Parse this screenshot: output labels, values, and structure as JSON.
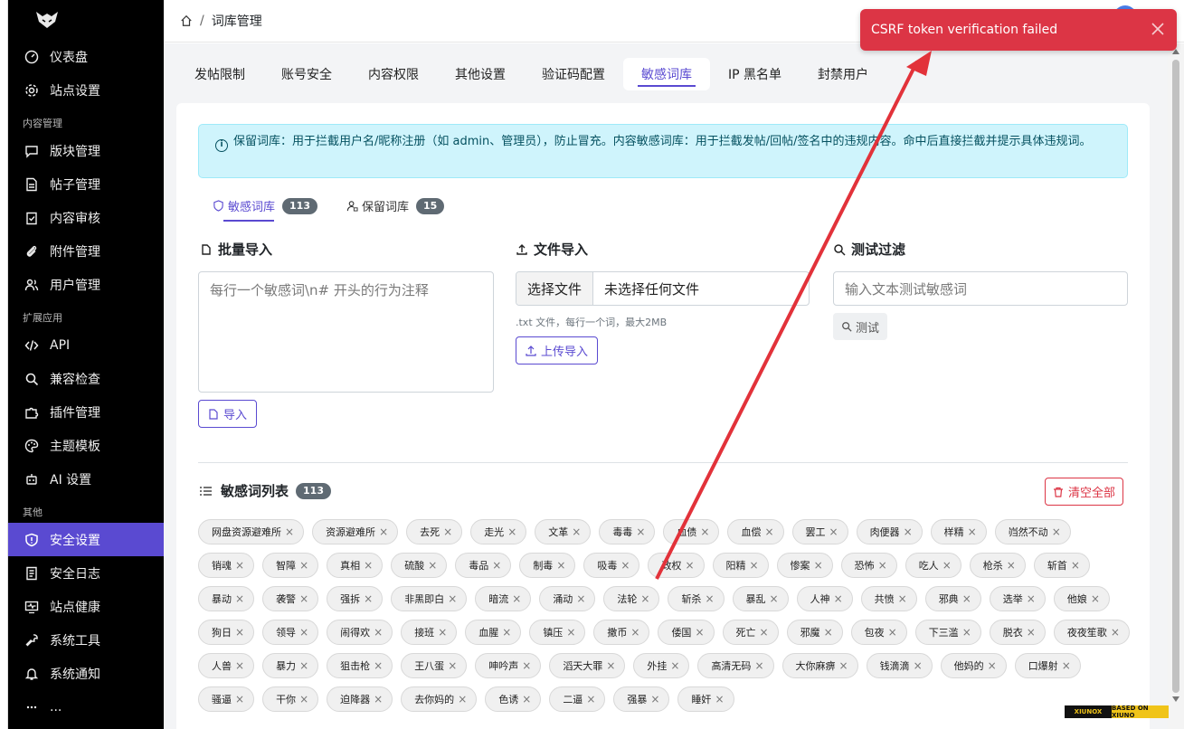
{
  "sidebar": {
    "items_top": [
      {
        "label": "仪表盘",
        "icon": "dashboard-icon"
      },
      {
        "label": "站点设置",
        "icon": "gear-icon"
      }
    ],
    "section_content": "内容管理",
    "items_content": [
      {
        "label": "版块管理",
        "icon": "chat-icon"
      },
      {
        "label": "帖子管理",
        "icon": "file-icon"
      },
      {
        "label": "内容审核",
        "icon": "clipboard-check-icon"
      },
      {
        "label": "附件管理",
        "icon": "paperclip-icon"
      },
      {
        "label": "用户管理",
        "icon": "users-icon"
      }
    ],
    "section_ext": "扩展应用",
    "items_ext": [
      {
        "label": "API",
        "icon": "code-icon"
      },
      {
        "label": "兼容检查",
        "icon": "search-icon"
      },
      {
        "label": "插件管理",
        "icon": "puzzle-icon"
      },
      {
        "label": "主题模板",
        "icon": "palette-icon"
      },
      {
        "label": "AI 设置",
        "icon": "robot-icon"
      }
    ],
    "section_other": "其他",
    "items_other": [
      {
        "label": "安全设置",
        "icon": "shield-icon",
        "active": true
      },
      {
        "label": "安全日志",
        "icon": "journal-icon"
      },
      {
        "label": "站点健康",
        "icon": "monitor-heart-icon"
      },
      {
        "label": "系统工具",
        "icon": "wrench-icon"
      },
      {
        "label": "系统通知",
        "icon": "bell-icon"
      },
      {
        "label": "...",
        "icon": "more-icon"
      }
    ]
  },
  "header": {
    "breadcrumb_sep": "/",
    "title": "词库管理"
  },
  "tabs": [
    "发帖限制",
    "账号安全",
    "内容权限",
    "其他设置",
    "验证码配置",
    "敏感词库",
    "IP 黑名单",
    "封禁用户"
  ],
  "active_tab": "敏感词库",
  "alert": {
    "text": "保留词库：用于拦截用户名/昵称注册（如 admin、管理员），防止冒充。内容敏感词库：用于拦截发帖/回帖/签名中的违规内容。命中后直接拦截并提示具体违规词。"
  },
  "subtabs": [
    {
      "label": "敏感词库",
      "count": "113",
      "active": true
    },
    {
      "label": "保留词库",
      "count": "15"
    }
  ],
  "batch": {
    "title": "批量导入",
    "placeholder": "每行一个敏感词\\n# 开头的行为注释",
    "button": "导入"
  },
  "file": {
    "title": "文件导入",
    "choose": "选择文件",
    "none": "未选择任何文件",
    "hint": ".txt 文件，每行一个词，最大2MB",
    "button": "上传导入"
  },
  "test": {
    "title": "测试过滤",
    "placeholder": "输入文本测试敏感词",
    "button": "测试"
  },
  "list": {
    "title": "敏感词列表",
    "count": "113",
    "clear": "清空全部"
  },
  "words": [
    "网盘资源避难所",
    "资源避难所",
    "去死",
    "走光",
    "文革",
    "毒毒",
    "血债",
    "血偿",
    "罢工",
    "肉便器",
    "样精",
    "岿然不动",
    "销魂",
    "智障",
    "真相",
    "硫酸",
    "毒品",
    "制毒",
    "吸毒",
    "政权",
    "阳精",
    "惨案",
    "恐怖",
    "吃人",
    "枪杀",
    "斩首",
    "暴动",
    "袭警",
    "强拆",
    "非黑即白",
    "暗流",
    "涌动",
    "法轮",
    "斩杀",
    "暴乱",
    "人神",
    "共愤",
    "邪典",
    "选举",
    "他娘",
    "狗日",
    "领导",
    "闹得欢",
    "接班",
    "血腥",
    "镇压",
    "撒币",
    "倭国",
    "死亡",
    "邪魔",
    "包夜",
    "下三滥",
    "脱衣",
    "夜夜笙歌",
    "人兽",
    "暴力",
    "狙击枪",
    "王八蛋",
    "呻吟声",
    "滔天大罪",
    "外挂",
    "高清无码",
    "大你麻痹",
    "钱滴滴",
    "他妈的",
    "口爆射",
    "骚逼",
    "干你",
    "迫降器",
    "去你妈的",
    "色诱",
    "二逼",
    "强暴",
    "睡奸"
  ],
  "toast": {
    "message": "CSRF token verification failed"
  },
  "watermark": {
    "left": "XIUNOX",
    "right": "BASED ON XIUNO"
  },
  "colors": {
    "accent": "#5a4ad1",
    "danger": "#dc3545",
    "info_bg": "#cff4fc"
  }
}
